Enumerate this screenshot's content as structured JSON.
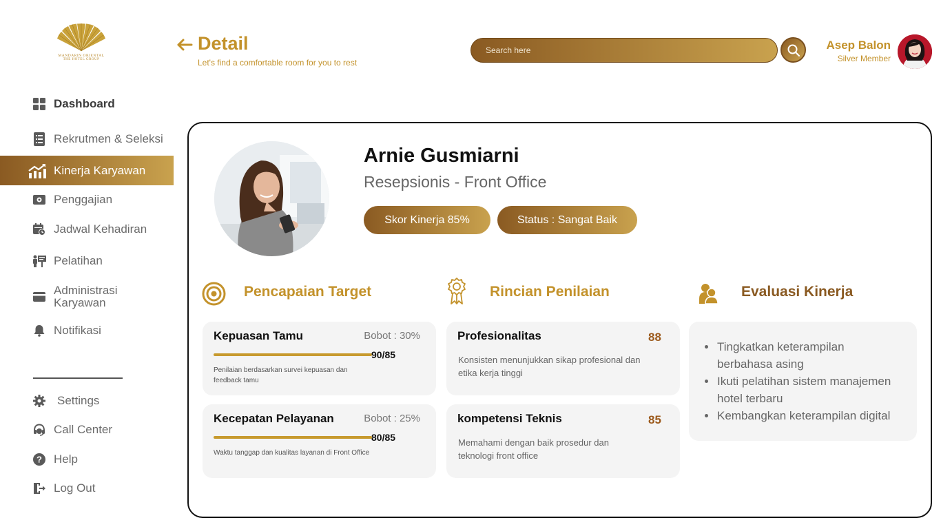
{
  "brand": {
    "line1": "MANDARIN ORIENTAL",
    "line2": "THE HOTEL GROUP",
    "color": "#c3922b"
  },
  "sidebar": {
    "items": [
      {
        "label": "Dashboard",
        "icon": "dashboard-grid-icon"
      },
      {
        "label": "Rekrutmen & Seleksi",
        "icon": "document-list-icon"
      },
      {
        "label": "Kinerja Karyawan",
        "icon": "chart-trend-icon",
        "active": true
      },
      {
        "label": "Penggajian",
        "icon": "payroll-icon"
      },
      {
        "label": "Jadwal Kehadiran",
        "icon": "calendar-clock-icon"
      },
      {
        "label": "Pelatihan",
        "icon": "training-icon"
      },
      {
        "label": "Administrasi Karyawan",
        "icon": "card-icon"
      },
      {
        "label": "Notifikasi",
        "icon": "bell-icon"
      }
    ],
    "bottom": [
      {
        "label": "Settings",
        "icon": "gear-icon"
      },
      {
        "label": "Call Center",
        "icon": "headset-icon"
      },
      {
        "label": "Help",
        "icon": "help-icon"
      },
      {
        "label": "Log Out",
        "icon": "logout-icon"
      }
    ]
  },
  "header": {
    "title": "Detail",
    "subtitle": "Let's find a comfortable room for you to rest",
    "search_placeholder": "Search here",
    "user_name": "Asep Balon",
    "user_tier": "Silver Member"
  },
  "employee": {
    "name": "Arnie Gusmiarni",
    "role": "Resepsionis - Front Office",
    "score_label": "Skor Kinerja 85%",
    "status_label": "Status : Sangat Baik"
  },
  "sections": {
    "target": {
      "title": "Pencapaian Target",
      "items": [
        {
          "name": "Kepuasan Tamu",
          "weight": "Bobot : 30%",
          "value": "90/85",
          "progress": 1.0,
          "desc": "Penilaian berdasarkan survei kepuasan dan feedback tamu"
        },
        {
          "name": "Kecepatan Pelayanan",
          "weight": "Bobot : 25%",
          "value": "80/85",
          "progress": 0.94,
          "desc": " Waktu tanggap dan kualitas layanan di Front Office"
        }
      ]
    },
    "rincian": {
      "title": "Rincian Penilaian",
      "items": [
        {
          "name": "Profesionalitas",
          "score": "88",
          "desc": "Konsisten menunjukkan sikap profesional dan etika kerja tinggi"
        },
        {
          "name": "kompetensi Teknis",
          "score": "85",
          "desc": "Memahami dengan baik prosedur dan teknologi front office"
        }
      ]
    },
    "evaluasi": {
      "title": "Evaluasi Kinerja",
      "items": [
        "Tingkatkan keterampilan berbahasa asing",
        "Ikuti pelatihan sistem manajemen hotel terbaru",
        "Kembangkan keterampilan digital"
      ]
    }
  },
  "colors": {
    "gold": "#c3922b",
    "gold_dark": "#8a5a22",
    "gold_light": "#c9a24e",
    "brown_title": "#8a5a22",
    "score_brown": "#9c5a1c",
    "progress": "#c79a2e"
  }
}
